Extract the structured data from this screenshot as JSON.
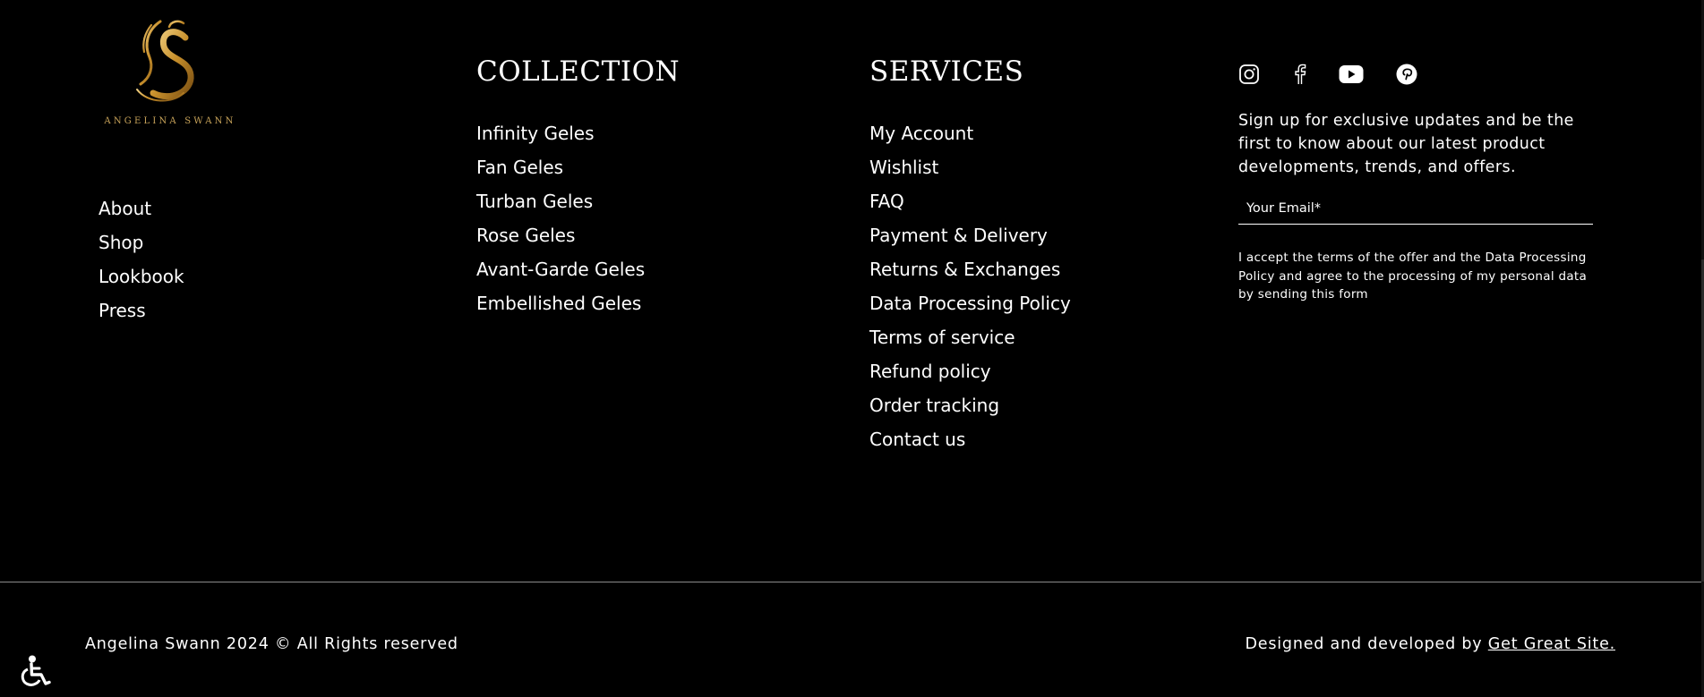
{
  "brand": {
    "logo_text": "ANGELINA SWANN",
    "gold": "#c9a45a"
  },
  "about_links": [
    "About",
    "Shop",
    "Lookbook",
    "Press"
  ],
  "collection": {
    "heading": "COLLECTION",
    "links": [
      "Infinity Geles",
      "Fan Geles",
      "Turban Geles",
      "Rose Geles",
      "Avant-Garde Geles",
      "Embellished Geles"
    ]
  },
  "services": {
    "heading": "SERVICES",
    "links": [
      "My Account",
      "Wishlist",
      "FAQ",
      "Payment & Delivery",
      "Returns & Exchanges",
      "Data Processing Policy",
      "Terms of service",
      "Refund policy",
      "Order tracking",
      "Contact us"
    ]
  },
  "social_icons": [
    "instagram-icon",
    "facebook-icon",
    "youtube-icon",
    "pinterest-icon"
  ],
  "newsletter": {
    "text": "Sign up for exclusive updates and be the first to know about our latest product developments, trends, and offers.",
    "email_placeholder": "Your Email*",
    "consent": "I accept the terms of the offer and the Data Processing Policy and agree to the processing of my personal data by sending this form"
  },
  "footer": {
    "copyright": "Angelina Swann 2024 © All Rights reserved",
    "credit_prefix": "Designed and developed by",
    "credit_link": "Get Great Site."
  },
  "accessibility_icon": "wheelchair-icon"
}
